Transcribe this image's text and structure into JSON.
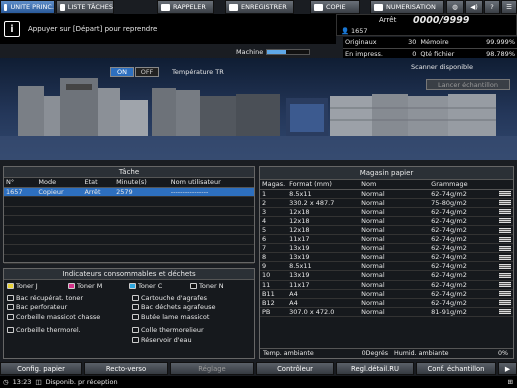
{
  "tabs": [
    {
      "label": "UNITE PRINC.",
      "icon": "printer-icon"
    },
    {
      "label": "LISTE TÂCHES",
      "icon": "list-icon"
    },
    {
      "label": "RAPPELER",
      "icon": "folder-icon"
    },
    {
      "label": "ENREGISTRER",
      "icon": "save-icon"
    },
    {
      "label": "COPIE",
      "icon": "copy-icon"
    },
    {
      "label": "NUMERISATION",
      "icon": "scan-icon"
    }
  ],
  "message": "Appuyer sur [Départ] pour reprendre",
  "counter": {
    "label": "Arrêt",
    "value": "0000/9999",
    "job": "1657"
  },
  "stats": {
    "originaux_label": "Originaux",
    "originaux": "30",
    "memoire_label": "Mémoire",
    "memoire": "99.999%",
    "en_impress_label": "En impress.",
    "en_impress": "0",
    "qte_fichier_label": "Qté fichier",
    "qte_fichier": "98.789%"
  },
  "machine": {
    "label": "Machine",
    "progress": 0.45
  },
  "toggle": {
    "on": "ON",
    "off": "OFF",
    "label": "Température TR"
  },
  "scanner": {
    "status": "Scanner disponible",
    "button": "Lancer échantillon"
  },
  "tache": {
    "title": "Tâche",
    "headers": [
      "N°",
      "Mode",
      "Etat",
      "Minute(s)",
      "Nom utilisateur"
    ],
    "rows": [
      [
        "1657",
        "Copieur",
        "Arrêt",
        "2579",
        "----------------"
      ]
    ]
  },
  "consommables": {
    "title": "Indicateurs consommables et déchets",
    "items": [
      {
        "label": "Toner J"
      },
      {
        "label": "Toner M"
      },
      {
        "label": "Toner C"
      },
      {
        "label": "Toner N"
      },
      {
        "label": "Bac récupérat. toner"
      },
      {
        "label": "Cartouche d'agrafes"
      },
      {
        "label": "Bac perforateur"
      },
      {
        "label": "Bac déchets agrafeuse"
      },
      {
        "label": "Corbeille massicot chasse"
      },
      {
        "label": "Butée lame massicot"
      },
      {
        "label": "Corbeille thermorel."
      },
      {
        "label": "Colle thermorelieur"
      },
      {
        "label": "Réservoir d'eau"
      }
    ]
  },
  "magasin": {
    "title": "Magasin papier",
    "headers": [
      "Magas.",
      "Format (mm)",
      "Nom",
      "Grammage"
    ],
    "rows": [
      [
        "1",
        "8.5x11",
        "Normal",
        "62-74g/m2"
      ],
      [
        "2",
        "330.2 x 487.7",
        "Normal",
        "75-80g/m2"
      ],
      [
        "3",
        "12x18",
        "Normal",
        "62-74g/m2"
      ],
      [
        "4",
        "12x18",
        "Normal",
        "62-74g/m2"
      ],
      [
        "5",
        "12x18",
        "Normal",
        "62-74g/m2"
      ],
      [
        "6",
        "11x17",
        "Normal",
        "62-74g/m2"
      ],
      [
        "7",
        "13x19",
        "Normal",
        "62-74g/m2"
      ],
      [
        "8",
        "13x19",
        "Normal",
        "62-74g/m2"
      ],
      [
        "9",
        "8.5x11",
        "Normal",
        "62-74g/m2"
      ],
      [
        "10",
        "13x19",
        "Normal",
        "62-74g/m2"
      ],
      [
        "11",
        "11x17",
        "Normal",
        "62-74g/m2"
      ],
      [
        "B11",
        "A4",
        "Normal",
        "62-74g/m2"
      ],
      [
        "B12",
        "A4",
        "Normal",
        "62-74g/m2"
      ],
      [
        "PB",
        "307.0 x 472.0",
        "Normal",
        "81-91g/m2"
      ]
    ],
    "temp_label": "Temp. ambiante",
    "temp": "0Degrés",
    "humid_label": "Humid. ambiante",
    "humid": "0%"
  },
  "bottom_buttons": [
    {
      "label": "Config. papier",
      "enabled": true
    },
    {
      "label": "Recto-verso",
      "enabled": true
    },
    {
      "label": "Réglage",
      "enabled": false
    },
    {
      "label": "Contrôleur",
      "enabled": true
    },
    {
      "label": "Regl.détail.RU",
      "enabled": true
    },
    {
      "label": "Conf. échantillon",
      "enabled": true
    }
  ],
  "status": {
    "time": "13:23",
    "text": "Disponib. pr réception"
  },
  "colors": {
    "accent": "#2d6fbf",
    "background": "#1a1d22"
  }
}
